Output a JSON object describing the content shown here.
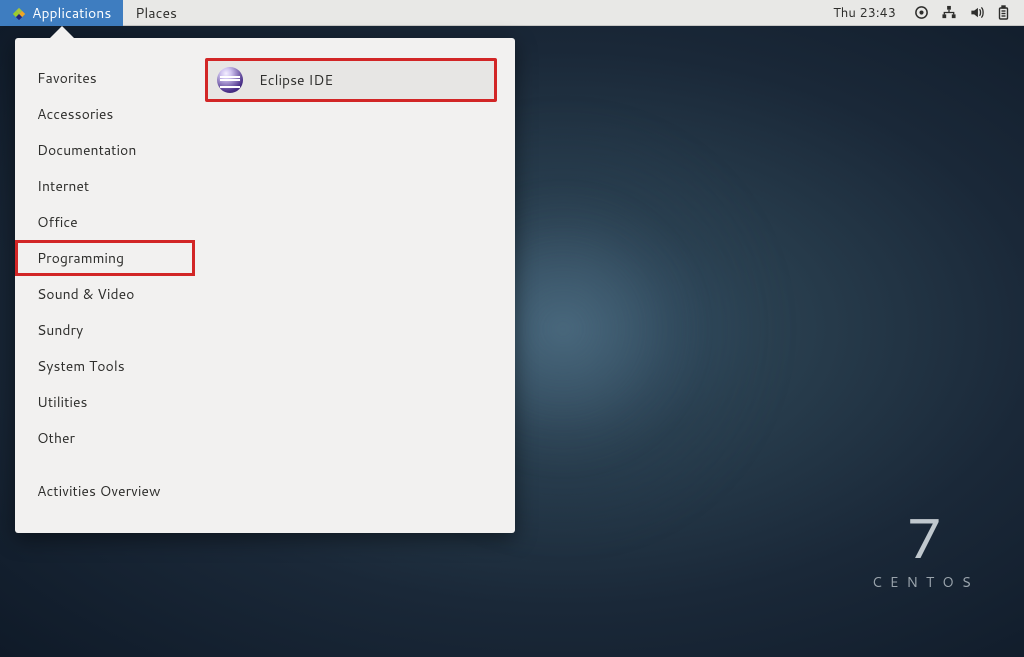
{
  "panel": {
    "applications": "Applications",
    "places": "Places",
    "clock": "Thu 23:43"
  },
  "menu": {
    "categories": [
      "Favorites",
      "Accessories",
      "Documentation",
      "Internet",
      "Office",
      "Programming",
      "Sound & Video",
      "Sundry",
      "System Tools",
      "Utilities",
      "Other"
    ],
    "highlighted_category_index": 5,
    "activities": "Activities Overview",
    "apps": [
      {
        "label": "Eclipse IDE",
        "icon": "eclipse",
        "highlighted": true
      }
    ]
  },
  "branding": {
    "version": "7",
    "name": "CENTOS"
  }
}
